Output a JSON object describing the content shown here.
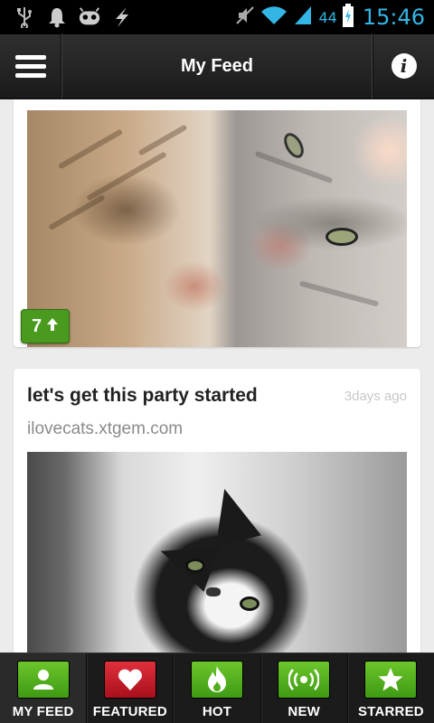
{
  "status_bar": {
    "icons": [
      "usb-icon",
      "notification-bell-icon",
      "android-icon",
      "lightning-icon",
      "mute-icon",
      "wifi-icon",
      "signal-icon",
      "battery-icon"
    ],
    "battery_level": "44",
    "time": "15:46",
    "accent_color": "#33b5e5"
  },
  "action_bar": {
    "title": "My Feed",
    "menu_icon": "hamburger-menu-icon",
    "info_icon": "info-icon"
  },
  "feed": {
    "posts": [
      {
        "votes": "7",
        "vote_icon": "up-arrow-icon",
        "image": "two-kittens-photo"
      },
      {
        "title": "let's get this party started",
        "time_ago": "3days ago",
        "source": "ilovecats.xtgem.com",
        "image": "black-white-cat-photo"
      }
    ]
  },
  "tab_bar": {
    "tabs": [
      {
        "label": "MY FEED",
        "icon": "user-icon",
        "color": "#4caf22",
        "active": true
      },
      {
        "label": "FEATURED",
        "icon": "heart-icon",
        "color": "#d0202c",
        "active": false
      },
      {
        "label": "HOT",
        "icon": "flame-icon",
        "color": "#4caf22",
        "active": false
      },
      {
        "label": "NEW",
        "icon": "broadcast-icon",
        "color": "#4caf22",
        "active": false
      },
      {
        "label": "STARRED",
        "icon": "star-icon",
        "color": "#4caf22",
        "active": false
      }
    ]
  }
}
